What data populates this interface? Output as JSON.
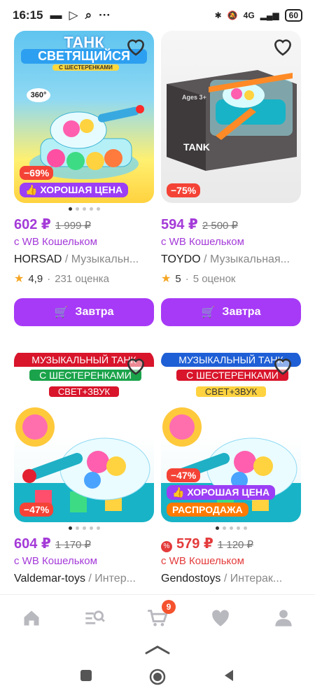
{
  "status": {
    "time": "16:15",
    "battery": "60",
    "network": "4G"
  },
  "products": [
    {
      "discount": "−69%",
      "badge": "ХОРОШАЯ ЦЕНА",
      "price": "602 ₽",
      "old_price": "1 999 ₽",
      "wallet": "с WB Кошельком",
      "brand": "HORSAD",
      "category": " / Музыкальн...",
      "rating": "4,9",
      "reviews": "231 оценка",
      "button": "Завтра",
      "photo_texts": {
        "title1": "ТАНК",
        "title2": "СВЕТЯЩИЙСЯ",
        "sub": "С ШЕСТЕРЕНКАМИ",
        "badge360": "360°"
      }
    },
    {
      "discount": "−75%",
      "price": "594 ₽",
      "old_price": "2 500 ₽",
      "wallet": "с WB Кошельком",
      "brand": "TOYDO",
      "category": " / Музыкальная...",
      "rating": "5",
      "reviews": "5 оценок",
      "button": "Завтра",
      "photo_texts": {
        "box_label": "TANK",
        "age": "Ages 3+"
      }
    },
    {
      "discount": "−47%",
      "price": "604 ₽",
      "old_price": "1 170 ₽",
      "wallet": "с WB Кошельком",
      "brand": "Valdemar-toys",
      "category": " / Интер...",
      "photo_texts": {
        "line1": "МУЗЫКАЛЬНЫЙ ТАНК",
        "line2": "С ШЕСТЕРЕНКАМИ",
        "line3": "СВЕТ+ЗВУК"
      }
    },
    {
      "discount": "−47%",
      "badge": "ХОРОШАЯ ЦЕНА",
      "sale": "РАСПРОДАЖА",
      "price": "579 ₽",
      "old_price": "1 120 ₽",
      "wallet": "с WB Кошельком",
      "brand": "Gendostoys",
      "category": " / Интерак...",
      "photo_texts": {
        "line1": "МУЗЫКАЛЬНЫЙ ТАНК",
        "line2": "С ШЕСТЕРЕНКАМИ",
        "line3": "СВЕТ+ЗВУК"
      }
    }
  ],
  "nav": {
    "cart_count": "9"
  },
  "colors": {
    "accent": "#a73af6",
    "discount": "#f44336",
    "sale": "#ff7a00"
  }
}
